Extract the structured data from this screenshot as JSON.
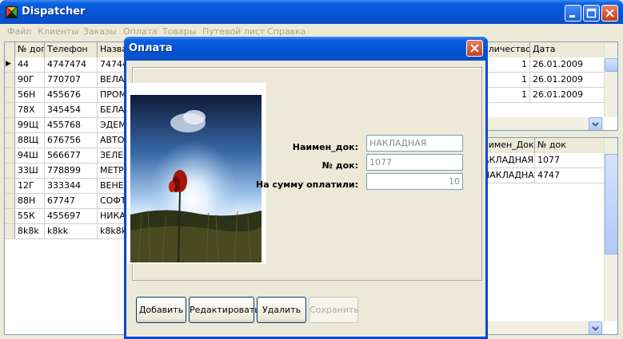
{
  "app": {
    "title": "Dispatcher",
    "colors": {
      "titlebar": "#0553d4",
      "close": "#c43c14"
    }
  },
  "menu": [
    "Файл",
    "Клиенты",
    "Заказы",
    "Оплата",
    "Товары",
    "Путевой лист",
    "Справка"
  ],
  "clients_grid": {
    "columns": [
      "№ дог",
      "Телефон",
      "Назва"
    ],
    "rows": [
      [
        "44",
        "4747474",
        "74744"
      ],
      [
        "90Г",
        "770707",
        "ВЕЛАЙ"
      ],
      [
        "56Н",
        "455676",
        "ПРОМ"
      ],
      [
        "78Х",
        "345454",
        "БЕЛАГ"
      ],
      [
        "99Щ",
        "455768",
        "ЭДЕМ"
      ],
      [
        "88Щ",
        "676756",
        "АВТОЛ"
      ],
      [
        "94Ш",
        "566677",
        "ЗЕЛЕН"
      ],
      [
        "33Ш",
        "778899",
        "МЕТРО"
      ],
      [
        "12Г",
        "333344",
        "ВЕНЕР"
      ],
      [
        "88Н",
        "67747",
        "СОФТ"
      ],
      [
        "55К",
        "455697",
        "НИКА"
      ],
      [
        "8k8k",
        "k8kk",
        "k8k8k"
      ]
    ],
    "current_row_marker": "▶"
  },
  "orders_grid": {
    "columns": [
      "оличество",
      "Дата"
    ],
    "rows": [
      [
        "1",
        "26.01.2009"
      ],
      [
        "1",
        "26.01.2009"
      ],
      [
        "1",
        "26.01.2009"
      ]
    ]
  },
  "payments_grid": {
    "columns": [
      "аимен_Док",
      "№ док"
    ],
    "rows": [
      [
        "АКЛАДНАЯ",
        "1077"
      ],
      [
        "НАКЛАДНА",
        "4747"
      ]
    ]
  },
  "dialog": {
    "title": "Оплата",
    "fields": [
      {
        "label": "Наимен_док:",
        "value": "НАКЛАДНАЯ"
      },
      {
        "label": "№ док:",
        "value": "1077"
      },
      {
        "label": "На сумму оплатили:",
        "value": "10"
      }
    ],
    "buttons": {
      "add": "Добавить",
      "edit": "Редактировать",
      "delete": "Удалить",
      "save": "Сохранить"
    }
  }
}
